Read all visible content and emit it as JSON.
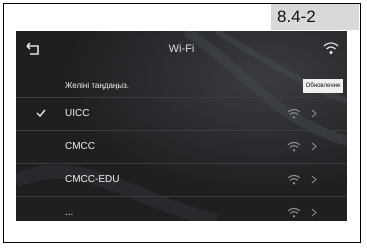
{
  "figure_tag": "8.4-2",
  "header": {
    "title": "Wi-Fi",
    "back_icon": "back-arrow-icon",
    "wifi_icon": "wifi-icon"
  },
  "subheader": {
    "choose_label": "Желіні таңдаңыз.",
    "refresh_label": "Обновление"
  },
  "networks": [
    {
      "ssid": "UICC",
      "connected": true
    },
    {
      "ssid": "CMCC",
      "connected": false
    },
    {
      "ssid": "CMCC-EDU",
      "connected": false
    },
    {
      "ssid": "...",
      "connected": false
    }
  ],
  "colors": {
    "screen_bg": "#1d1f21",
    "text": "#e9e9e9",
    "tag_bg": "#d9d9d9"
  }
}
